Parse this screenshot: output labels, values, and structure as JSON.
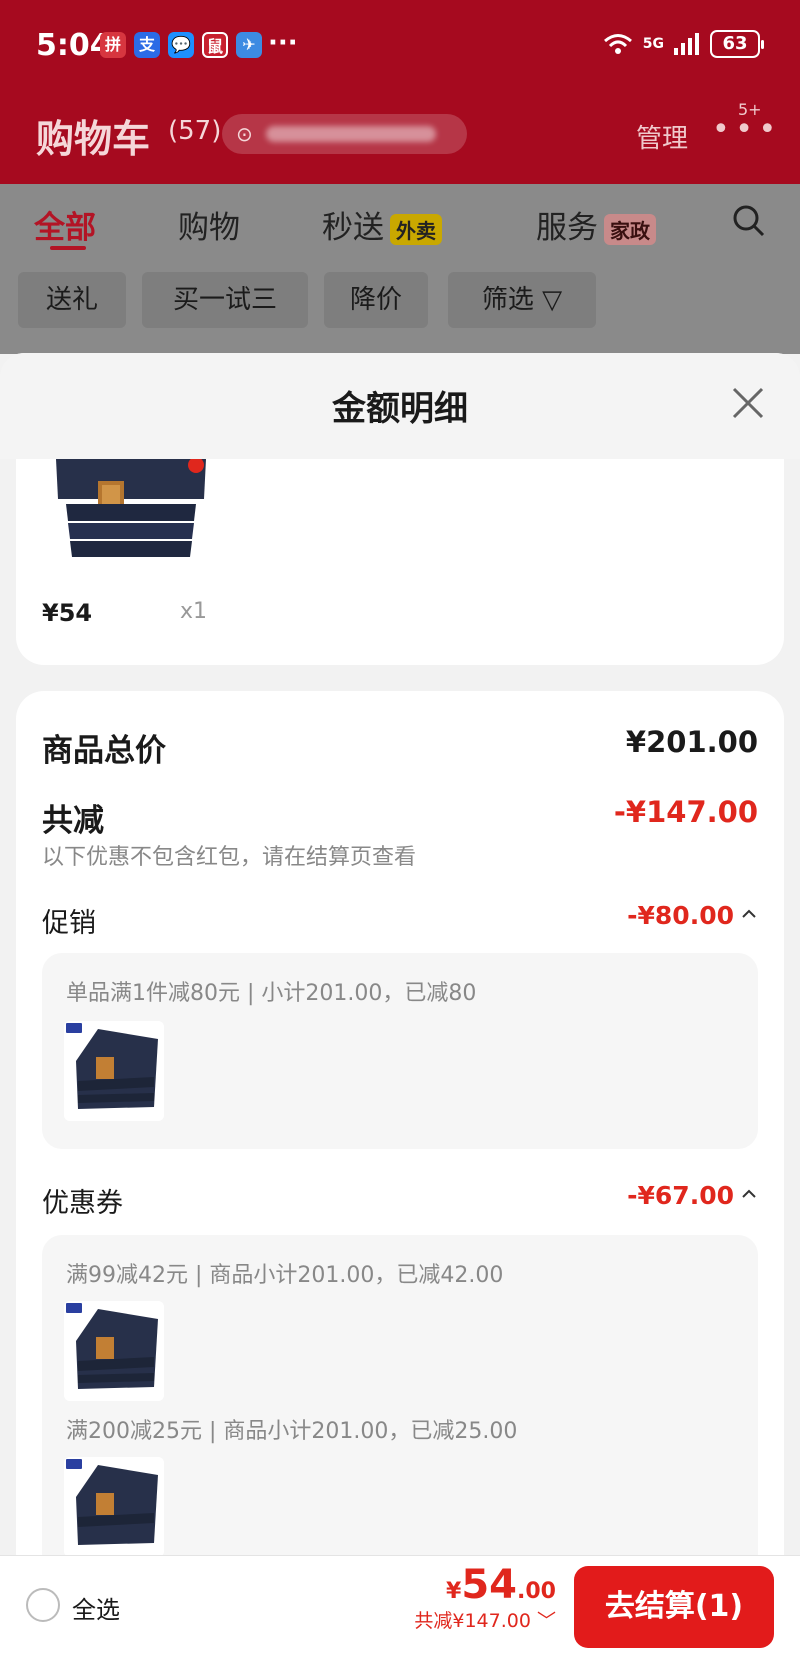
{
  "status_bar": {
    "time": "5:04",
    "notification_icons": [
      "拼",
      "支",
      "💬",
      "鼠",
      "✈"
    ],
    "more": "···",
    "network": "5G",
    "battery": "63"
  },
  "header": {
    "title": "购物车",
    "count": "(57)",
    "manage": "管理",
    "more_badge": "5+"
  },
  "tabs": [
    {
      "label": "全部",
      "tag": ""
    },
    {
      "label": "购物",
      "tag": ""
    },
    {
      "label": "秒送",
      "tag": "外卖"
    },
    {
      "label": "服务",
      "tag": "家政"
    }
  ],
  "chips": [
    "送礼",
    "买一试三",
    "降价",
    "筛选 ▽"
  ],
  "sheet": {
    "title": "金额明细",
    "item": {
      "price": "¥54",
      "qty": "x1"
    },
    "summary": {
      "goods_total_label": "商品总价",
      "goods_total_value": "¥201.00",
      "reduce_label": "共减",
      "reduce_value": "-¥147.00",
      "note": "以下优惠不包含红包，请在结算页查看"
    },
    "promo": {
      "label": "促销",
      "value": "-¥80.00",
      "lines": [
        "单品满1件减80元 | 小计201.00，已减80"
      ]
    },
    "coupon": {
      "label": "优惠券",
      "value": "-¥67.00",
      "lines": [
        "满99减42元 | 商品小计201.00，已减42.00",
        "满200减25元 | 商品小计201.00，已减25.00"
      ]
    }
  },
  "bottom_bar": {
    "select_all": "全选",
    "currency": "¥",
    "total_int": "54",
    "total_dec": ".00",
    "reduce_text": "共减¥147.00",
    "checkout_label": "去结算(1)"
  },
  "colors": {
    "brand_red": "#e0271d",
    "header_red": "#a60a1f",
    "checkout_red": "#e21b1b"
  }
}
